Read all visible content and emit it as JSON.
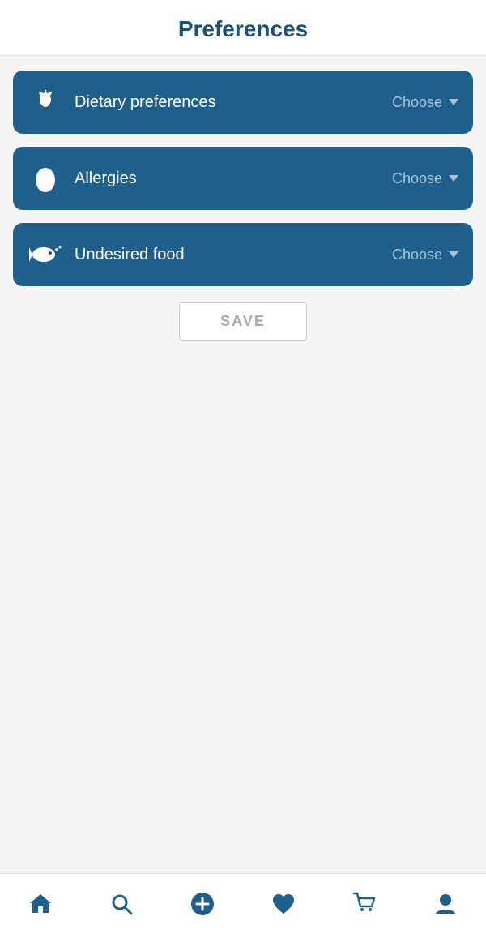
{
  "header": {
    "title": "Preferences"
  },
  "rows": [
    {
      "id": "dietary",
      "icon": "apple-icon",
      "label": "Dietary preferences",
      "choose_label": "Choose"
    },
    {
      "id": "allergies",
      "icon": "egg-icon",
      "label": "Allergies",
      "choose_label": "Choose"
    },
    {
      "id": "undesired",
      "icon": "fish-icon",
      "label": "Undesired food",
      "choose_label": "Choose"
    }
  ],
  "save_button": "SAVE",
  "nav": {
    "items": [
      {
        "id": "home",
        "icon": "home-icon"
      },
      {
        "id": "search",
        "icon": "search-icon"
      },
      {
        "id": "add",
        "icon": "add-icon"
      },
      {
        "id": "favorites",
        "icon": "heart-icon"
      },
      {
        "id": "cart",
        "icon": "cart-icon"
      },
      {
        "id": "profile",
        "icon": "profile-icon"
      }
    ]
  }
}
